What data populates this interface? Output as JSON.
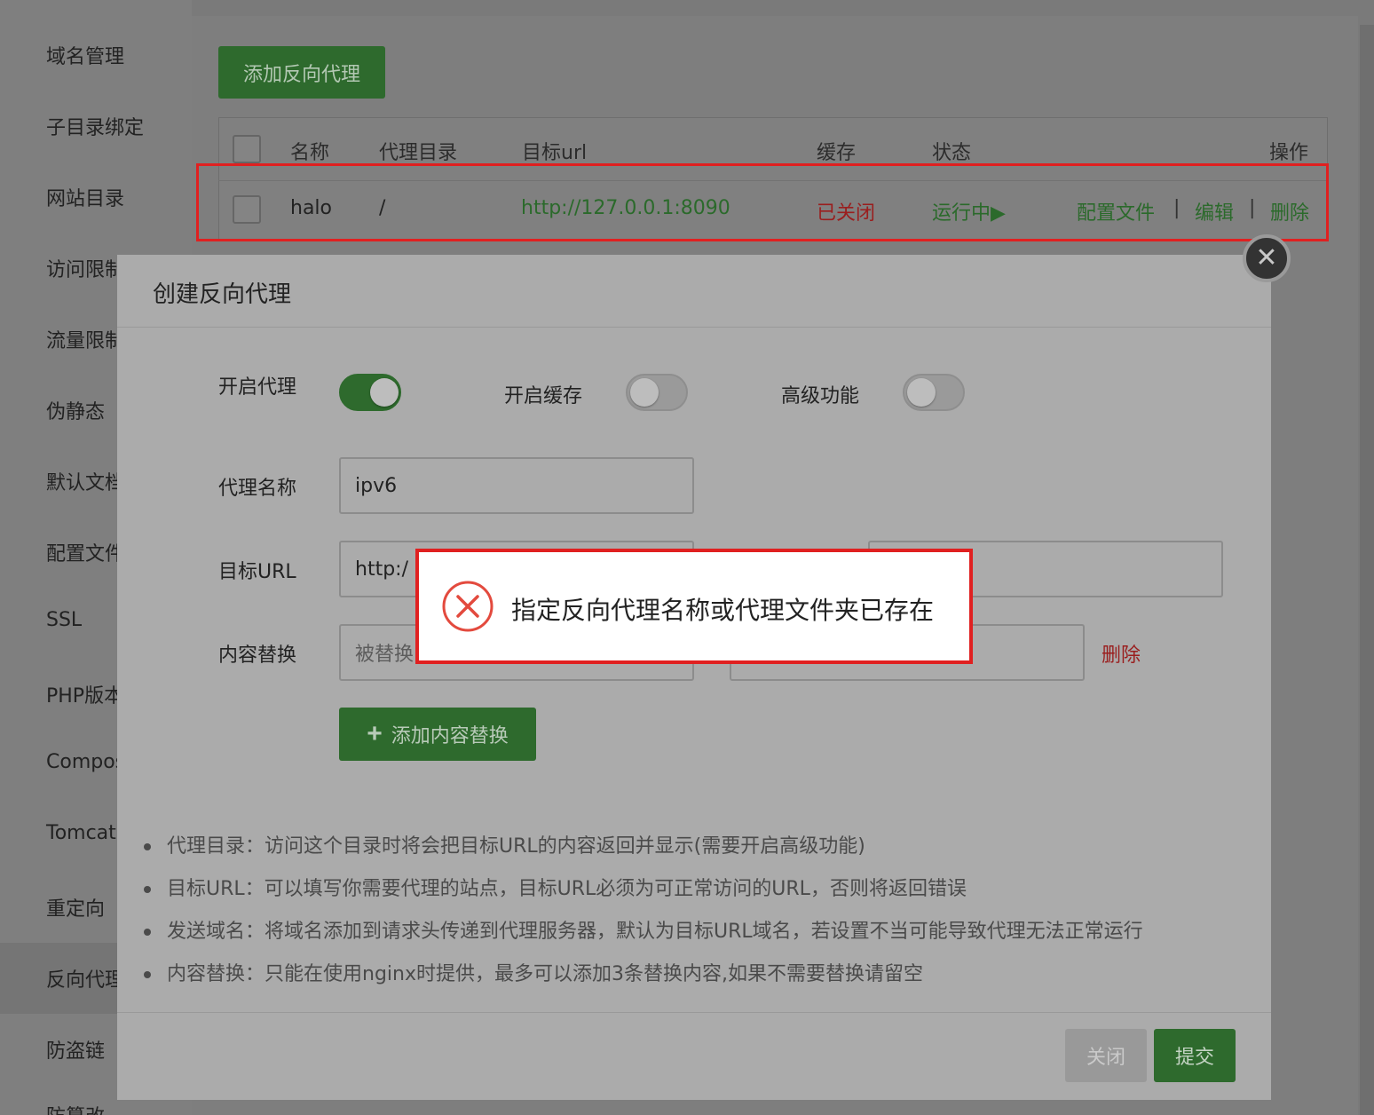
{
  "sidebar": {
    "items": [
      "域名管理",
      "子目录绑定",
      "网站目录",
      "访问限制",
      "流量限制",
      "伪静态",
      "默认文档",
      "配置文件",
      "SSL",
      "PHP版本",
      "Composer",
      "Tomcat",
      "重定向",
      "反向代理",
      "防盗链",
      "防篡改"
    ]
  },
  "toolbar": {
    "add_proxy_label": "添加反向代理"
  },
  "table": {
    "headers": [
      "名称",
      "代理目录",
      "目标url",
      "缓存",
      "状态",
      "操作"
    ],
    "rows": [
      {
        "name": "halo",
        "dir": "/",
        "url": "http://127.0.0.1:8090",
        "cache": "已关闭",
        "status": "运行中▶",
        "actions": [
          "配置文件",
          "编辑",
          "删除"
        ],
        "separator": "|"
      }
    ]
  },
  "modal": {
    "title": "创建反向代理",
    "close_glyph": "✕",
    "toggles": [
      {
        "label": "开启代理",
        "on": true
      },
      {
        "label": "开启缓存",
        "on": false
      },
      {
        "label": "高级功能",
        "on": false
      }
    ],
    "fields": {
      "name_label": "代理名称",
      "name_value": "ipv6",
      "url_label": "目标URL",
      "url_value": "http:/",
      "replace_label": "内容替换",
      "replace_placeholder": "被替换",
      "delete_label": "删除"
    },
    "add_replace_label": "添加内容替换",
    "add_replace_icon": "plus-icon",
    "notes": [
      "代理目录：访问这个目录时将会把目标URL的内容返回并显示(需要开启高级功能)",
      "目标URL：可以填写你需要代理的站点，目标URL必须为可正常访问的URL，否则将返回错误",
      "发送域名：将域名添加到请求头传递到代理服务器，默认为目标URL域名，若设置不当可能导致代理无法正常运行",
      "内容替换：只能在使用nginx时提供，最多可以添加3条替换内容,如果不需要替换请留空"
    ],
    "close_label": "关闭",
    "submit_label": "提交"
  },
  "toast": {
    "message": "指定反向代理名称或代理文件夹已存在",
    "icon": "error-circle-icon"
  },
  "colors": {
    "green": "#2e6a2d",
    "link_green": "#2b6a2b",
    "red": "#9a1e1e",
    "highlight_red": "#e02020"
  }
}
